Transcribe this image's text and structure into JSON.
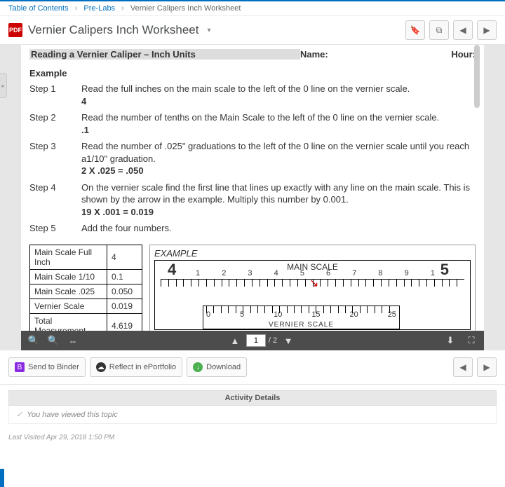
{
  "breadcrumb": {
    "toc": "Table of Contents",
    "prelabs": "Pre-Labs",
    "current": "Vernier Calipers Inch Worksheet"
  },
  "page_title": "Vernier Calipers Inch Worksheet",
  "doc": {
    "heading": "Reading a Vernier Caliper – Inch Units",
    "name_label": "Name:",
    "hour_label": "Hour:",
    "example_label": "Example",
    "steps": [
      {
        "label": "Step 1",
        "text": "Read the full inches on the main scale to the left of the 0 line on the vernier scale.",
        "bold": "4"
      },
      {
        "label": "Step 2",
        "text": "Read the number of tenths on the Main Scale to the left of the 0 line on the vernier scale.",
        "bold": ".1"
      },
      {
        "label": "Step 3",
        "text": "Read the number of .025\" graduations to the left of the 0 line on the vernier scale until you reach a1/10\" graduation.",
        "bold": "2 X .025 = .050"
      },
      {
        "label": "Step 4",
        "text": "On the vernier scale find the first line that lines up exactly with any line on the main scale.  This is shown by the arrow in the example.  Multiply this number by 0.001.",
        "bold": "19 X .001 = 0.019"
      },
      {
        "label": "Step 5",
        "text": "Add the four numbers.",
        "bold": ""
      }
    ],
    "table": {
      "rows": [
        {
          "k": "Main Scale Full Inch",
          "v": "4"
        },
        {
          "k": "Main Scale 1/10",
          "v": "0.1"
        },
        {
          "k": "Main Scale .025",
          "v": "0.050"
        },
        {
          "k": "Vernier Scale",
          "v": "0.019"
        },
        {
          "k": "Total Measurement",
          "v": "4.619"
        }
      ]
    },
    "diagram": {
      "example_label": "EXAMPLE",
      "main_scale_label": "MAIN SCALE",
      "big_left": "4",
      "big_right": "5",
      "small_nums": [
        "1",
        "2",
        "3",
        "4",
        "5",
        "6",
        "7",
        "8",
        "9",
        "1"
      ],
      "vernier_nums": [
        "0",
        "5",
        "10",
        "15",
        "20",
        "25"
      ],
      "vernier_label": "VERNIER SCALE"
    }
  },
  "viewer": {
    "page_current": "1",
    "page_total": "/ 2"
  },
  "actions": {
    "send_binder": "Send to Binder",
    "reflect": "Reflect in ePortfolio",
    "download": "Download"
  },
  "activity": {
    "header": "Activity Details",
    "viewed": "You have viewed this topic"
  },
  "last_visited": "Last Visited Apr 29, 2018 1:50 PM"
}
